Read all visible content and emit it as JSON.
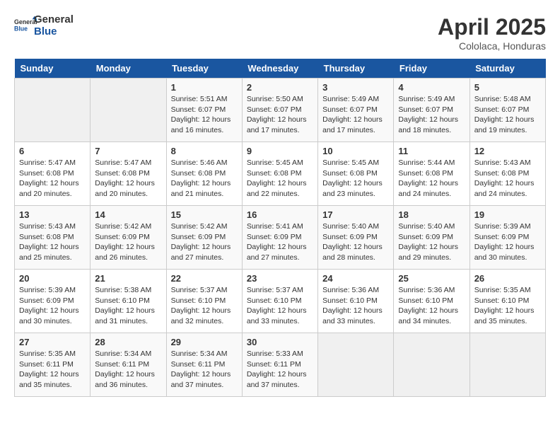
{
  "header": {
    "logo_general": "General",
    "logo_blue": "Blue",
    "month_year": "April 2025",
    "location": "Cololaca, Honduras"
  },
  "days_of_week": [
    "Sunday",
    "Monday",
    "Tuesday",
    "Wednesday",
    "Thursday",
    "Friday",
    "Saturday"
  ],
  "weeks": [
    [
      {
        "day": "",
        "info": ""
      },
      {
        "day": "",
        "info": ""
      },
      {
        "day": "1",
        "info": "Sunrise: 5:51 AM\nSunset: 6:07 PM\nDaylight: 12 hours and 16 minutes."
      },
      {
        "day": "2",
        "info": "Sunrise: 5:50 AM\nSunset: 6:07 PM\nDaylight: 12 hours and 17 minutes."
      },
      {
        "day": "3",
        "info": "Sunrise: 5:49 AM\nSunset: 6:07 PM\nDaylight: 12 hours and 17 minutes."
      },
      {
        "day": "4",
        "info": "Sunrise: 5:49 AM\nSunset: 6:07 PM\nDaylight: 12 hours and 18 minutes."
      },
      {
        "day": "5",
        "info": "Sunrise: 5:48 AM\nSunset: 6:07 PM\nDaylight: 12 hours and 19 minutes."
      }
    ],
    [
      {
        "day": "6",
        "info": "Sunrise: 5:47 AM\nSunset: 6:08 PM\nDaylight: 12 hours and 20 minutes."
      },
      {
        "day": "7",
        "info": "Sunrise: 5:47 AM\nSunset: 6:08 PM\nDaylight: 12 hours and 20 minutes."
      },
      {
        "day": "8",
        "info": "Sunrise: 5:46 AM\nSunset: 6:08 PM\nDaylight: 12 hours and 21 minutes."
      },
      {
        "day": "9",
        "info": "Sunrise: 5:45 AM\nSunset: 6:08 PM\nDaylight: 12 hours and 22 minutes."
      },
      {
        "day": "10",
        "info": "Sunrise: 5:45 AM\nSunset: 6:08 PM\nDaylight: 12 hours and 23 minutes."
      },
      {
        "day": "11",
        "info": "Sunrise: 5:44 AM\nSunset: 6:08 PM\nDaylight: 12 hours and 24 minutes."
      },
      {
        "day": "12",
        "info": "Sunrise: 5:43 AM\nSunset: 6:08 PM\nDaylight: 12 hours and 24 minutes."
      }
    ],
    [
      {
        "day": "13",
        "info": "Sunrise: 5:43 AM\nSunset: 6:08 PM\nDaylight: 12 hours and 25 minutes."
      },
      {
        "day": "14",
        "info": "Sunrise: 5:42 AM\nSunset: 6:09 PM\nDaylight: 12 hours and 26 minutes."
      },
      {
        "day": "15",
        "info": "Sunrise: 5:42 AM\nSunset: 6:09 PM\nDaylight: 12 hours and 27 minutes."
      },
      {
        "day": "16",
        "info": "Sunrise: 5:41 AM\nSunset: 6:09 PM\nDaylight: 12 hours and 27 minutes."
      },
      {
        "day": "17",
        "info": "Sunrise: 5:40 AM\nSunset: 6:09 PM\nDaylight: 12 hours and 28 minutes."
      },
      {
        "day": "18",
        "info": "Sunrise: 5:40 AM\nSunset: 6:09 PM\nDaylight: 12 hours and 29 minutes."
      },
      {
        "day": "19",
        "info": "Sunrise: 5:39 AM\nSunset: 6:09 PM\nDaylight: 12 hours and 30 minutes."
      }
    ],
    [
      {
        "day": "20",
        "info": "Sunrise: 5:39 AM\nSunset: 6:09 PM\nDaylight: 12 hours and 30 minutes."
      },
      {
        "day": "21",
        "info": "Sunrise: 5:38 AM\nSunset: 6:10 PM\nDaylight: 12 hours and 31 minutes."
      },
      {
        "day": "22",
        "info": "Sunrise: 5:37 AM\nSunset: 6:10 PM\nDaylight: 12 hours and 32 minutes."
      },
      {
        "day": "23",
        "info": "Sunrise: 5:37 AM\nSunset: 6:10 PM\nDaylight: 12 hours and 33 minutes."
      },
      {
        "day": "24",
        "info": "Sunrise: 5:36 AM\nSunset: 6:10 PM\nDaylight: 12 hours and 33 minutes."
      },
      {
        "day": "25",
        "info": "Sunrise: 5:36 AM\nSunset: 6:10 PM\nDaylight: 12 hours and 34 minutes."
      },
      {
        "day": "26",
        "info": "Sunrise: 5:35 AM\nSunset: 6:10 PM\nDaylight: 12 hours and 35 minutes."
      }
    ],
    [
      {
        "day": "27",
        "info": "Sunrise: 5:35 AM\nSunset: 6:11 PM\nDaylight: 12 hours and 35 minutes."
      },
      {
        "day": "28",
        "info": "Sunrise: 5:34 AM\nSunset: 6:11 PM\nDaylight: 12 hours and 36 minutes."
      },
      {
        "day": "29",
        "info": "Sunrise: 5:34 AM\nSunset: 6:11 PM\nDaylight: 12 hours and 37 minutes."
      },
      {
        "day": "30",
        "info": "Sunrise: 5:33 AM\nSunset: 6:11 PM\nDaylight: 12 hours and 37 minutes."
      },
      {
        "day": "",
        "info": ""
      },
      {
        "day": "",
        "info": ""
      },
      {
        "day": "",
        "info": ""
      }
    ]
  ]
}
